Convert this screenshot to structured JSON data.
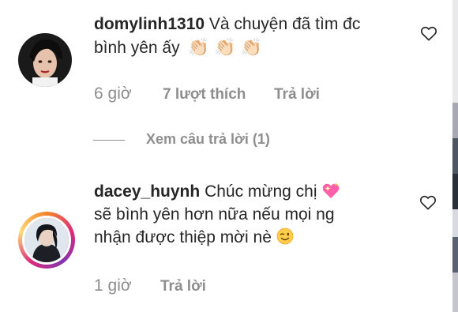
{
  "comments": [
    {
      "username": "domylinh1310",
      "line1": "Và chuyện đã tìm đc",
      "line2": "bình yên ấy",
      "emoji": "👏🏻 👏🏻 👏🏻",
      "time": "6 giờ",
      "likes": "7 lượt thích",
      "reply": "Trả lời",
      "view_replies": "Xem câu trả lời (1)"
    },
    {
      "username": "dacey_huynh",
      "line1": "Chúc mừng chị",
      "line2": "sẽ bình yên hơn nữa nếu mọi ng",
      "line3": "nhận được thiệp mời nè",
      "time": "1 giờ",
      "reply": "Trả lời"
    }
  ],
  "icons": [
    "heart-outline-icon",
    "sparkling-heart-emoji",
    "winking-face-emoji",
    "clapping-hands-emoji"
  ]
}
